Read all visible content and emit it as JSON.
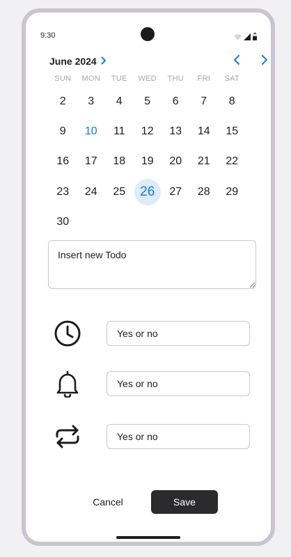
{
  "status_bar": {
    "time": "9:30"
  },
  "calendar": {
    "month_label": "June 2024",
    "weekdays": [
      "SUN",
      "MON",
      "TUE",
      "WED",
      "THU",
      "FRI",
      "SAT"
    ],
    "days": [
      "2",
      "3",
      "4",
      "5",
      "6",
      "7",
      "8",
      "9",
      "10",
      "11",
      "12",
      "13",
      "14",
      "15",
      "16",
      "17",
      "18",
      "19",
      "20",
      "21",
      "22",
      "23",
      "24",
      "25",
      "26",
      "27",
      "28",
      "29",
      "30"
    ],
    "today": "10",
    "selected": "26",
    "accent_color": "#0b7cde",
    "selected_bg": "#deecf9"
  },
  "todo": {
    "placeholder": "Insert new Todo"
  },
  "options": [
    {
      "icon": "clock-icon",
      "placeholder": "Yes or no"
    },
    {
      "icon": "bell-icon",
      "placeholder": "Yes or no"
    },
    {
      "icon": "repeat-icon",
      "placeholder": "Yes or no"
    }
  ],
  "actions": {
    "cancel_label": "Cancel",
    "save_label": "Save"
  }
}
